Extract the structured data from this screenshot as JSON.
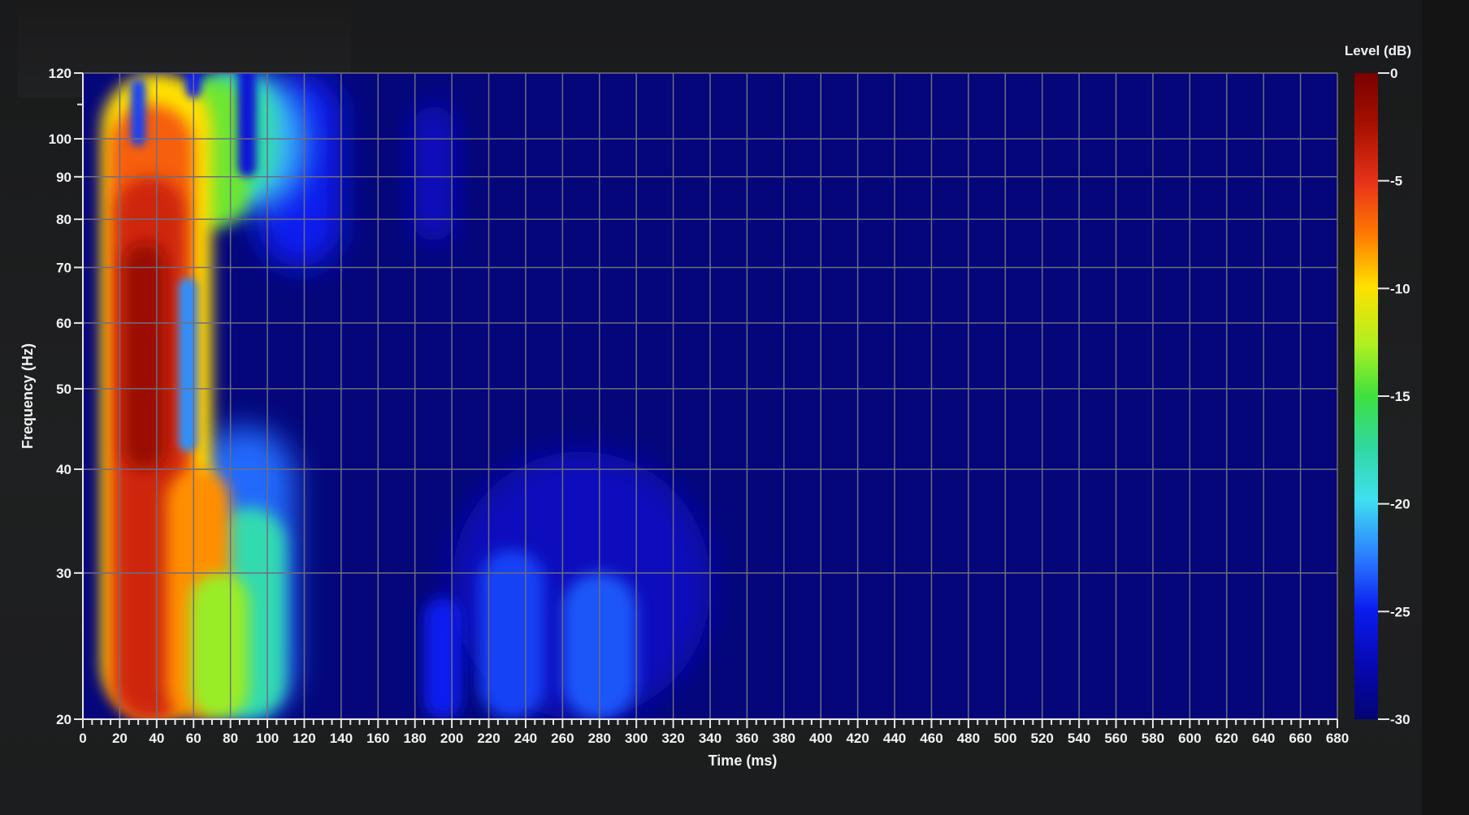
{
  "chart_data": {
    "type": "heatmap",
    "title": "",
    "xlabel": "Time (ms)",
    "ylabel": "Frequency (Hz)",
    "xlim": [
      0,
      680
    ],
    "ylim": [
      20,
      120
    ],
    "yscale": "log",
    "x_ticks": [
      "0",
      "20",
      "40",
      "60",
      "80",
      "100",
      "120",
      "140",
      "160",
      "180",
      "200",
      "220",
      "240",
      "260",
      "280",
      "300",
      "320",
      "340",
      "360",
      "380",
      "400",
      "420",
      "440",
      "460",
      "480",
      "500",
      "520",
      "540",
      "560",
      "580",
      "600",
      "620",
      "640",
      "660",
      "680"
    ],
    "y_ticks": [
      "20",
      "30",
      "40",
      "50",
      "60",
      "70",
      "80",
      "90",
      "100",
      "120"
    ],
    "grid": true,
    "colorbar": {
      "label": "Level (dB)",
      "range": [
        -30,
        0
      ],
      "ticks": [
        "0",
        "-5",
        "-10",
        "-15",
        "-20",
        "-25",
        "-30"
      ],
      "colormap": "jet"
    },
    "features": [
      {
        "t0": 10,
        "t1": 140,
        "f0": 20,
        "f1": 120,
        "level": "high",
        "peak_db": -1,
        "peak_time_ms": 30,
        "note": "main energy band, dark red 20-120 Hz"
      },
      {
        "t0": 60,
        "t1": 110,
        "f0": 80,
        "f1": 120,
        "level": "mid",
        "peak_db": -15
      },
      {
        "t0": 80,
        "t1": 110,
        "f0": 20,
        "f1": 40,
        "level": "mid",
        "peak_db": -18
      },
      {
        "t0": 180,
        "t1": 200,
        "f0": 75,
        "f1": 110,
        "level": "low",
        "peak_db": -27
      },
      {
        "t0": 210,
        "t1": 330,
        "f0": 20,
        "f1": 40,
        "level": "low",
        "peak_db": -22
      }
    ]
  }
}
